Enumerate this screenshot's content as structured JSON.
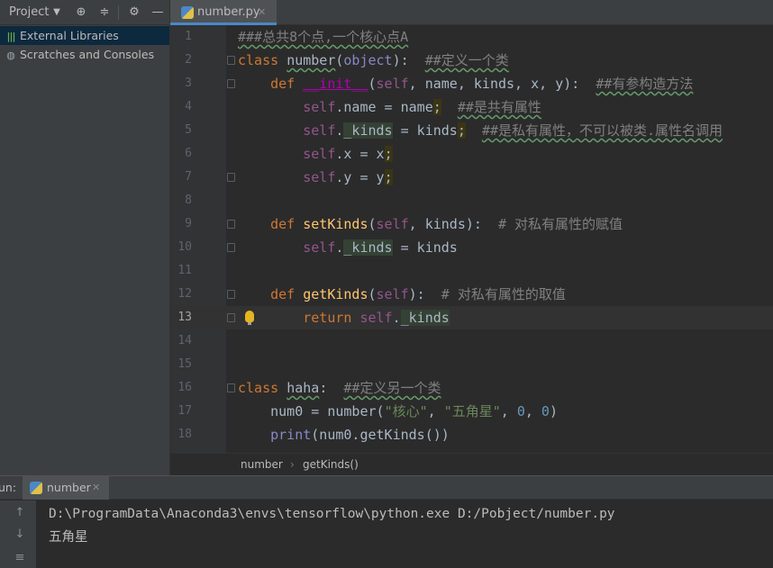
{
  "sidebar": {
    "title": "Project",
    "items": [
      {
        "label": "External Libraries"
      },
      {
        "label": "Scratches and Consoles"
      }
    ]
  },
  "editor": {
    "tab": {
      "label": "number.py"
    },
    "breadcrumbs": [
      "number",
      "getKinds()"
    ],
    "lines": [
      {
        "n": "1"
      },
      {
        "n": "2"
      },
      {
        "n": "3"
      },
      {
        "n": "4"
      },
      {
        "n": "5"
      },
      {
        "n": "6"
      },
      {
        "n": "7"
      },
      {
        "n": "8"
      },
      {
        "n": "9"
      },
      {
        "n": "10"
      },
      {
        "n": "11"
      },
      {
        "n": "12"
      },
      {
        "n": "13"
      },
      {
        "n": "14"
      },
      {
        "n": "15"
      },
      {
        "n": "16"
      },
      {
        "n": "17"
      },
      {
        "n": "18"
      }
    ],
    "code": {
      "l1": "###总共8个点,一个核心点A",
      "l2_kw": "class",
      "l2_name": "number",
      "l2_base": "object",
      "l2_cmt": "##定义一个类",
      "l3_kw": "def",
      "l3_name": "__init__",
      "l3_self": "self",
      "l3_params": ", name, kinds, x, y):",
      "l3_cmt": "##有参构造方法",
      "l4_self": "self",
      "l4_rest": ".name = name",
      "l4_semi": ";",
      "l4_cmt": "##是共有属性",
      "l5_self": "self",
      "l5_attr": "_kinds",
      "l5_rest": " = kinds",
      "l5_semi": ";",
      "l5_cmt": "##是私有属性，不可以被类.属性名调用",
      "l6_self": "self",
      "l6_rest": ".x = x",
      "l6_semi": ";",
      "l7_self": "self",
      "l7_rest": ".y = y",
      "l7_semi": ";",
      "l9_kw": "def",
      "l9_name": "setKinds",
      "l9_self": "self",
      "l9_params": ", kinds):",
      "l9_cmt": "# 对私有属性的赋值",
      "l10_self": "self",
      "l10_attr": "_kinds",
      "l10_rest": " = kinds",
      "l12_kw": "def",
      "l12_name": "getKinds",
      "l12_self": "self",
      "l12_params": "):",
      "l12_cmt": "# 对私有属性的取值",
      "l13_kw": "return",
      "l13_self": "self",
      "l13_attr": "_kinds",
      "l16_kw": "class",
      "l16_name": "haha",
      "l16_cmt": "##定义另一个类",
      "l17_pre": "num0 = number(",
      "l17_s1": "\"核心\"",
      "l17_s2": "\"五角星\"",
      "l17_n1": "0",
      "l17_n2": "0",
      "l18_kw": "print",
      "l18_rest": "(num0.getKinds())"
    }
  },
  "run": {
    "label": "un:",
    "tab_label": "number",
    "command": "D:\\ProgramData\\Anaconda3\\envs\\tensorflow\\python.exe D:/Pobject/number.py",
    "output": "五角星"
  },
  "colors": {
    "keyword": "#cc7832",
    "self": "#94558d",
    "comment": "#808080",
    "string": "#6a8759",
    "number": "#6897bb",
    "function": "#ffc66d",
    "text": "#a9b7c6",
    "selection": "#0d293e"
  }
}
